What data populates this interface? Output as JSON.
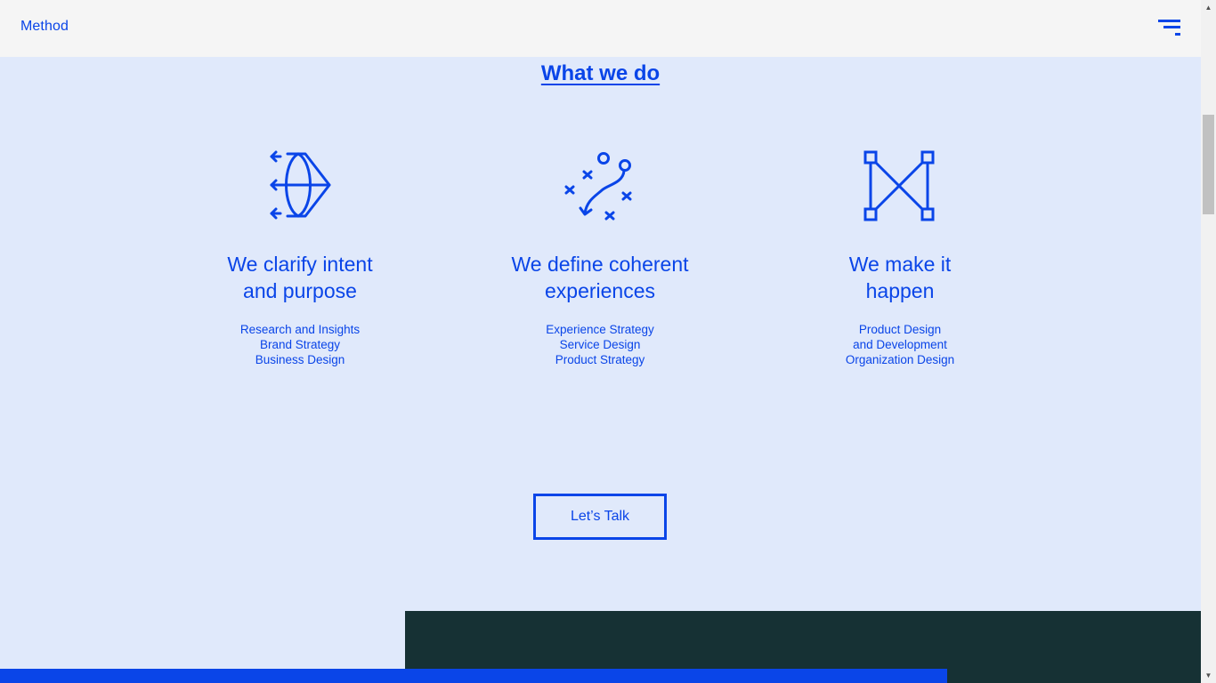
{
  "header": {
    "logo": "Method",
    "menu_icon": "hamburger-menu-icon"
  },
  "section": {
    "title": "What we do"
  },
  "services": [
    {
      "icon": "bow-and-arrow-icon",
      "heading_line1": "We clarify intent",
      "heading_line2": "and purpose",
      "items": [
        "Research and Insights",
        "Brand Strategy",
        "Business Design"
      ]
    },
    {
      "icon": "play-diagram-icon",
      "heading_line1": "We define coherent",
      "heading_line2": "experiences",
      "items": [
        "Experience Strategy",
        "Service Design",
        "Product Strategy"
      ]
    },
    {
      "icon": "vector-nodes-icon",
      "heading_line1": "We make it",
      "heading_line2": "happen",
      "items": [
        "Product Design",
        "and Development",
        "Organization Design"
      ]
    }
  ],
  "cta": {
    "label": "Let’s Talk"
  },
  "colors": {
    "accent": "#0a45e8",
    "background": "#e0e9fb",
    "header_bg": "#f5f5f5",
    "dark_block": "#163134"
  }
}
